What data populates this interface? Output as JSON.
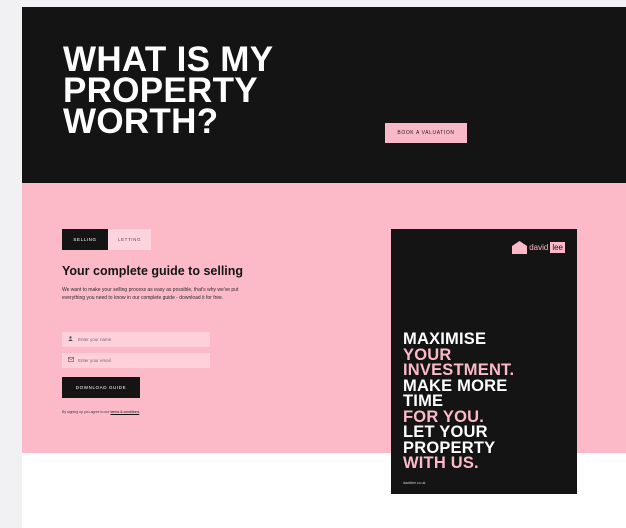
{
  "hero": {
    "title_lines": [
      "WHAT IS MY",
      "PROPERTY",
      "WORTH?"
    ],
    "valuation_button": "BOOK A VALUATION"
  },
  "guide": {
    "tabs": [
      {
        "label": "SELLING",
        "active": true
      },
      {
        "label": "LETTING",
        "active": false
      }
    ],
    "title": "Your complete guide to selling",
    "description": "We want to make your selling process as easy as possible, that's why we've put everything you need to know in our complete guide - download it for free.",
    "fields": [
      {
        "icon": "person-icon",
        "placeholder": "Enter your name"
      },
      {
        "icon": "email-icon",
        "placeholder": "Enter your email"
      }
    ],
    "download_button": "DOWNLOAD GUIDE",
    "legal_prefix": "By signing up you agree to our",
    "legal_link": "terms & conditions"
  },
  "card": {
    "logo_david": "david",
    "logo_lee": "lee",
    "lines": [
      {
        "text": "MAXIMISE",
        "color": "white"
      },
      {
        "text": "YOUR",
        "color": "pink"
      },
      {
        "text": "INVESTMENT.",
        "color": "pink"
      },
      {
        "text": "MAKE MORE",
        "color": "white"
      },
      {
        "text": "TIME",
        "color": "white"
      },
      {
        "text": "FOR YOU.",
        "color": "pink"
      },
      {
        "text": "LET YOUR",
        "color": "white"
      },
      {
        "text": "PROPERTY",
        "color": "white"
      },
      {
        "text": "WITH US.",
        "color": "pink"
      }
    ],
    "url": "davidlee.co.uk"
  },
  "colors": {
    "dark": "#141414",
    "pink": "#fcbac8",
    "light_pink": "#fdd0da"
  }
}
